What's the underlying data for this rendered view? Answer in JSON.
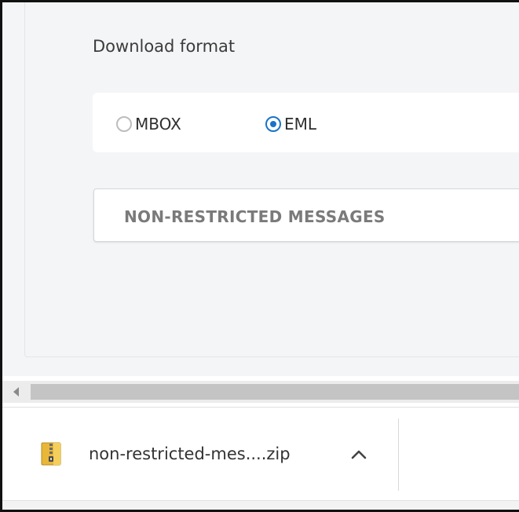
{
  "export_panel": {
    "format_label": "Download format",
    "options": [
      {
        "label": "MBOX",
        "selected": false
      },
      {
        "label": "EML",
        "selected": true
      }
    ],
    "action_button_label": "NON-RESTRICTED MESSAGES"
  },
  "download_shelf": {
    "filename": "non-restricted-mes....zip",
    "file_icon": "zip-archive-icon",
    "menu_icon": "chevron-up-icon"
  },
  "colors": {
    "accent": "#1a73c7",
    "zip_icon": "#e8b73a",
    "panel_bg": "#f4f5f7"
  }
}
